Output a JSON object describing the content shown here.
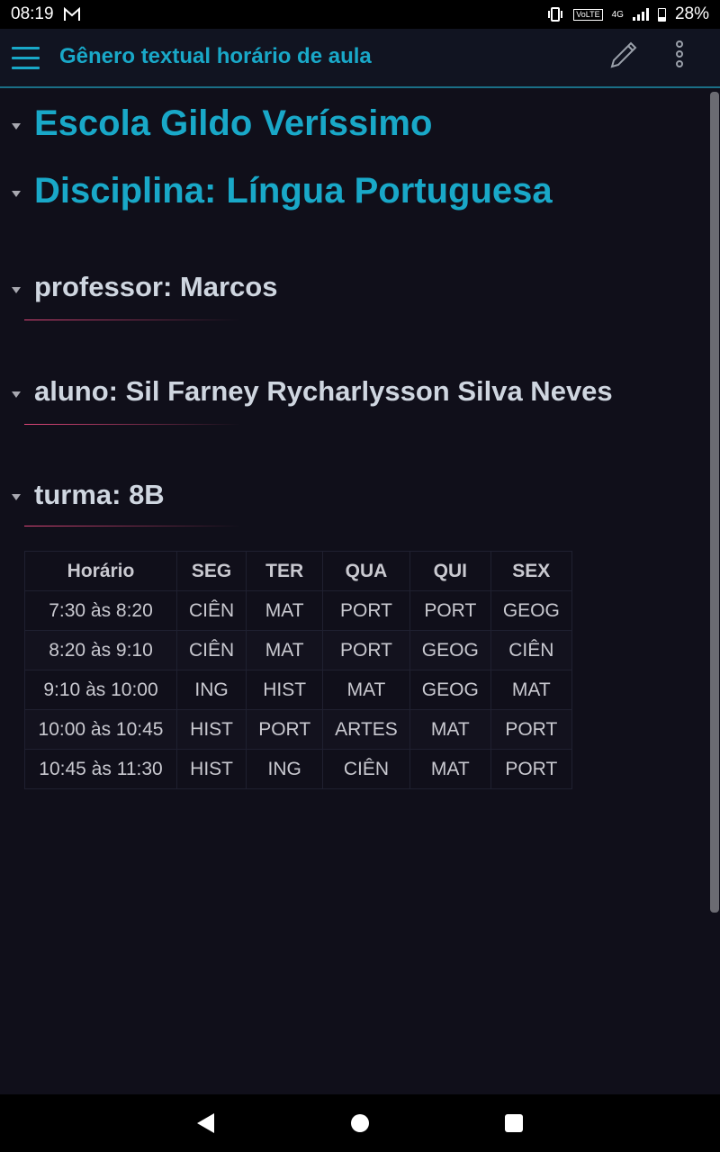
{
  "status_bar": {
    "time": "08:19",
    "gmail_icon": "gmail-icon",
    "volte": "VoLTE",
    "network": "4G",
    "battery": "28%"
  },
  "app_bar": {
    "title": "Gênero textual horário de aula",
    "accent_color": "#19a8c8"
  },
  "document": {
    "school": "Escola Gildo Veríssimo",
    "subject": "Disciplina: Língua Portuguesa",
    "teacher": "professor: Marcos",
    "student": "aluno: Sil Farney Rycharlysson Silva Neves",
    "class": "turma: 8B"
  },
  "schedule": {
    "headers": [
      "Horário",
      "SEG",
      "TER",
      "QUA",
      "QUI",
      "SEX"
    ],
    "rows": [
      [
        "7:30 às 8:20",
        "CIÊN",
        "MAT",
        "PORT",
        "PORT",
        "GEOG"
      ],
      [
        "8:20 às 9:10",
        "CIÊN",
        "MAT",
        "PORT",
        "GEOG",
        "CIÊN"
      ],
      [
        "9:10 às 10:00",
        "ING",
        "HIST",
        "MAT",
        "GEOG",
        "MAT"
      ],
      [
        "10:00 às 10:45",
        "HIST",
        "PORT",
        "ARTES",
        "MAT",
        "PORT"
      ],
      [
        "10:45 às 11:30",
        "HIST",
        "ING",
        "CIÊN",
        "MAT",
        "PORT"
      ]
    ]
  }
}
